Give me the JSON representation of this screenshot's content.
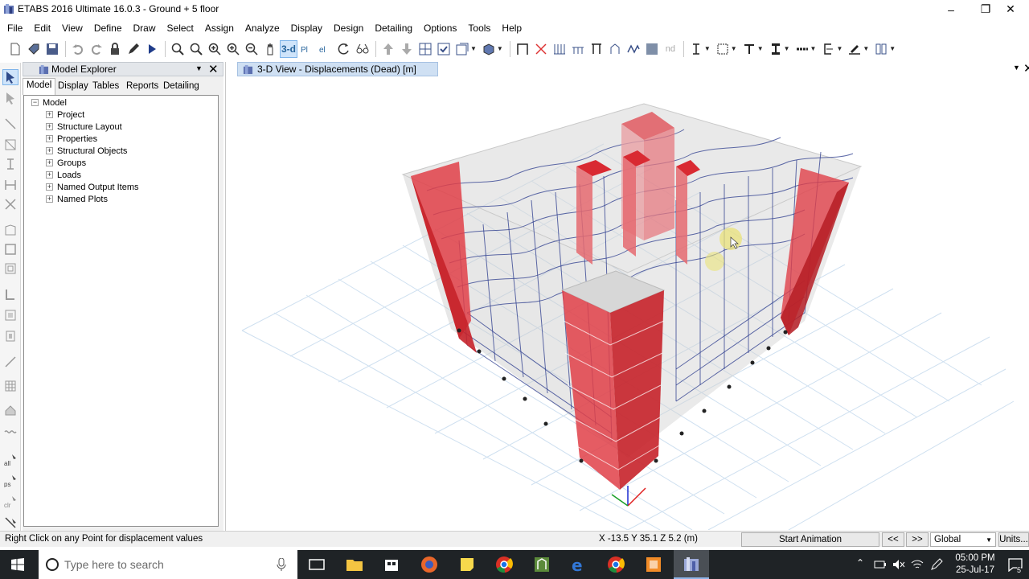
{
  "window": {
    "title": "ETABS 2016 Ultimate 16.0.3 - Ground + 5 floor",
    "minimize": "–",
    "maximize": "❐",
    "close": "✕"
  },
  "menu": [
    "File",
    "Edit",
    "View",
    "Define",
    "Draw",
    "Select",
    "Assign",
    "Analyze",
    "Display",
    "Design",
    "Detailing",
    "Options",
    "Tools",
    "Help"
  ],
  "toolbar": {
    "view_3d_label": "3-d",
    "view_plan_label": "Plan",
    "view_elev_label": "elev",
    "nd_label": "nd"
  },
  "explorer": {
    "title": "Model Explorer",
    "tabs": [
      "Model",
      "Display",
      "Tables",
      "Reports",
      "Detailing"
    ],
    "active_tab": "Model",
    "tree_root": "Model",
    "tree_items": [
      "Project",
      "Structure Layout",
      "Properties",
      "Structural Objects",
      "Groups",
      "Loads",
      "Named Output Items",
      "Named Plots"
    ]
  },
  "viewport": {
    "tab_title": "3-D View   - Displacements (Dead)  [m]",
    "accent_color": "#d9232b",
    "frame_color": "#2a3a8c"
  },
  "statusbar": {
    "hint": "Right Click on any Point for displacement values",
    "coords": "X -13.5  Y 35.1  Z 5.2 (m)",
    "start_animation": "Start Animation",
    "prev": "<<",
    "next": ">>",
    "coord_system": "Global",
    "units": "Units..."
  },
  "taskbar": {
    "search_placeholder": "Type here to search",
    "time": "05:00 PM",
    "date": "25-Jul-17",
    "notification_count": "5"
  }
}
